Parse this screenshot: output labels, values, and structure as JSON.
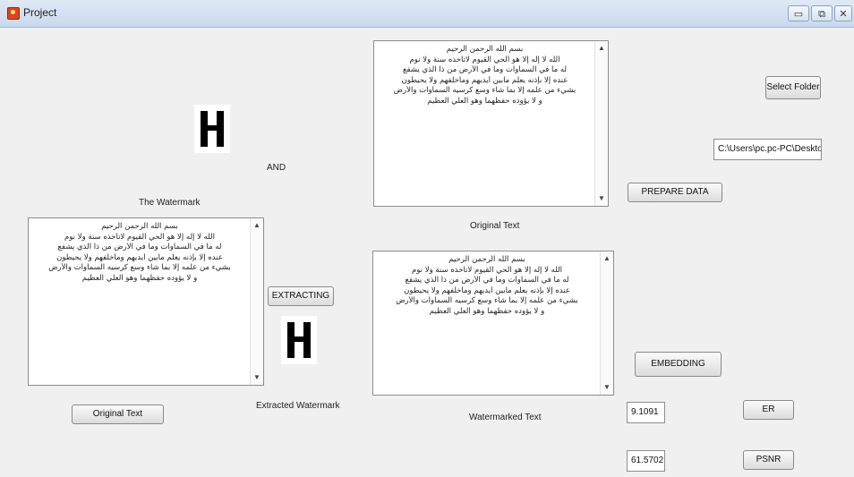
{
  "window": {
    "title": "Project",
    "controls": {
      "minimize": "▭",
      "maximize": "⧉",
      "close": "✕"
    }
  },
  "labels": {
    "and": "AND",
    "watermark": "The Watermark",
    "original_text": "Original  Text",
    "extracted_watermark": "Extracted Watermark",
    "watermarked_text": "Watermarked Text"
  },
  "buttons": {
    "select_folder": "Select Folder",
    "prepare_data": "PREPARE DATA",
    "extracting": "EXTRACTING",
    "embedding": "EMBEDDING",
    "original_text": "Original Text",
    "er": "ER",
    "psnr": "PSNR"
  },
  "fields": {
    "path": "C:\\Users\\pc.pc-PC\\Desktop",
    "er_value": "9.1091",
    "psnr_value": "61.5702"
  },
  "text_content": {
    "lines": [
      "بسم الله الرحمن الرحيم",
      "الله لا إله إلا هو الحي القيوم لاتأخذه سنة ولا نوم",
      "له ما في السماوات وما في الأرض من ذا الذي يشفع",
      "عنده إلا بإذنه يعلم مابين أيديهم وماخلفهم ولا يحيطون",
      "بشيء من علمه إلا بما شاء وسع كرسيه السماوات والأرض",
      "و لا يؤوده حفظهما وهو العلي العظيم"
    ]
  },
  "watermark_images": {
    "original": "letter-H-image",
    "extracted": "letter-H-image"
  }
}
